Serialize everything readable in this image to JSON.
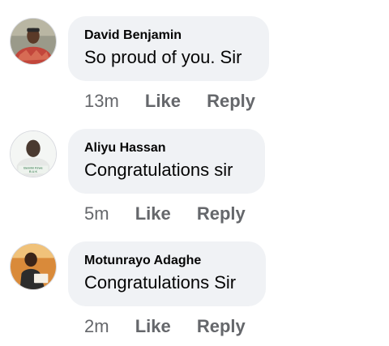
{
  "comments": [
    {
      "author": "David Benjamin",
      "text": "So proud of you. Sir",
      "time": "13m",
      "like_label": "Like",
      "reply_label": "Reply"
    },
    {
      "author": "Aliyu Hassan",
      "text": "Congratulations sir",
      "time": "5m",
      "like_label": "Like",
      "reply_label": "Reply",
      "avatar_caption": "Benniki Kirwe",
      "avatar_caption_2": "B.U.K"
    },
    {
      "author": "Motunrayo Adaghe",
      "text": "Congratulations Sir",
      "time": "2m",
      "like_label": "Like",
      "reply_label": "Reply"
    }
  ],
  "colors": {
    "bubble": "#f0f2f5",
    "author": "#050505",
    "meta": "#65676b"
  }
}
